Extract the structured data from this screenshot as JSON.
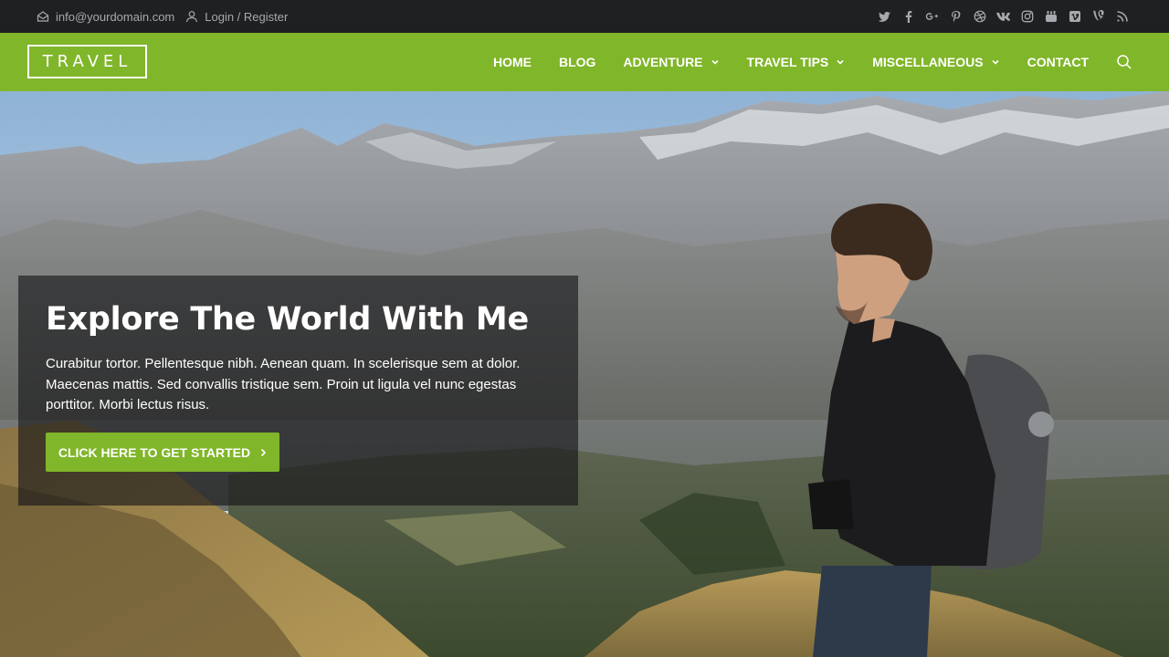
{
  "topbar": {
    "email": "info@yourdomain.com",
    "login": "Login / Register",
    "social": [
      "twitter-icon",
      "facebook-icon",
      "google-plus-icon",
      "pinterest-icon",
      "dribbble-icon",
      "vk-icon",
      "instagram-icon",
      "youtube-icon",
      "vimeo-icon",
      "vine-icon",
      "rss-icon"
    ]
  },
  "header": {
    "logo": "TRAVEL",
    "nav": [
      {
        "label": "HOME"
      },
      {
        "label": "BLOG"
      },
      {
        "label": "ADVENTURE"
      },
      {
        "label": "TRAVEL TIPS"
      },
      {
        "label": "MISCELLANEOUS"
      },
      {
        "label": "CONTACT"
      }
    ]
  },
  "hero": {
    "title": "Explore The World With Me",
    "text": "Curabitur tortor. Pellentesque nibh. Aenean quam. In scelerisque sem at dolor. Maecenas mattis. Sed convallis tristique sem. Proin ut ligula vel nunc egestas porttitor. Morbi lectus risus.",
    "cta": "CLICK HERE TO GET STARTED"
  },
  "colors": {
    "accent": "#80b62a",
    "topbar": "#1f2022"
  }
}
